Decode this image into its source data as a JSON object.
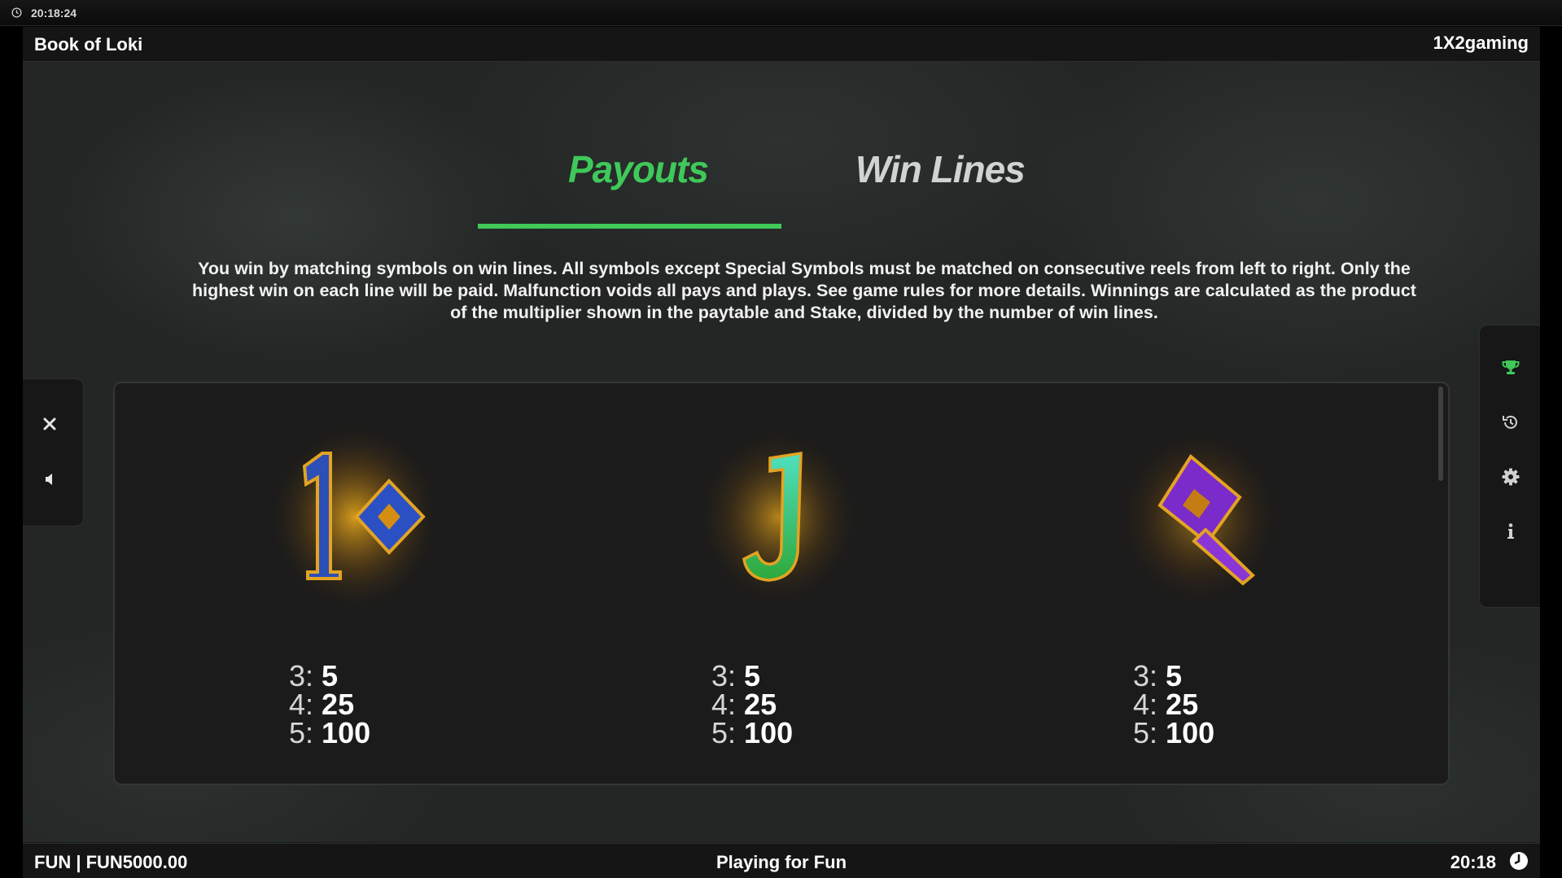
{
  "os": {
    "time": "20:18:24"
  },
  "header": {
    "title": "Book of Loki",
    "provider": "1X2gaming"
  },
  "tabs": [
    {
      "label": "Payouts",
      "active": true
    },
    {
      "label": "Win Lines",
      "active": false
    }
  ],
  "description": "You win by matching symbols on win lines. All symbols except Special Symbols must be matched on consecutive reels from left to right. Only the highest win on each line will be paid. Malfunction voids all pays and plays. See game rules for more details. Winnings are calculated as the product of the multiplier shown in the paytable and Stake, divided by the number of win lines.",
  "left_controls": [
    {
      "icon": "close-icon"
    },
    {
      "icon": "sound-icon"
    }
  ],
  "right_controls": [
    {
      "icon": "trophy-icon"
    },
    {
      "icon": "history-icon"
    },
    {
      "icon": "gear-icon"
    },
    {
      "icon": "info-icon"
    }
  ],
  "symbols": [
    {
      "name": "10",
      "pays": [
        {
          "k": "3:",
          "v": "5"
        },
        {
          "k": "4:",
          "v": "25"
        },
        {
          "k": "5:",
          "v": "100"
        }
      ]
    },
    {
      "name": "J",
      "pays": [
        {
          "k": "3:",
          "v": "5"
        },
        {
          "k": "4:",
          "v": "25"
        },
        {
          "k": "5:",
          "v": "100"
        }
      ]
    },
    {
      "name": "Q",
      "pays": [
        {
          "k": "3:",
          "v": "5"
        },
        {
          "k": "4:",
          "v": "25"
        },
        {
          "k": "5:",
          "v": "100"
        }
      ]
    }
  ],
  "footer": {
    "balance": "FUN | FUN5000.00",
    "mode": "Playing for Fun",
    "time": "20:18"
  },
  "colors": {
    "accent": "#3fc95a",
    "background": "#232625",
    "panel": "#1b1b1b"
  }
}
